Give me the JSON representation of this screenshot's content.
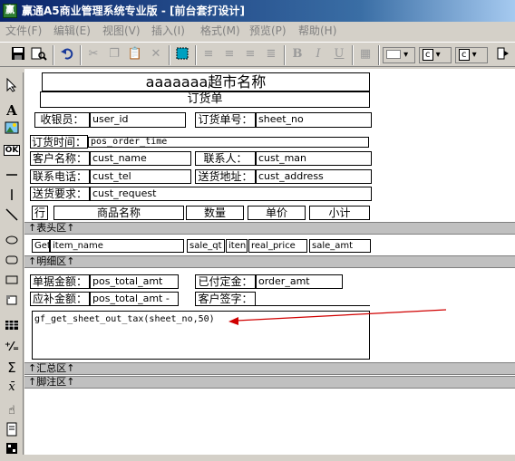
{
  "window": {
    "title": "赢通A5商业管理系统专业版 - [前台套打设计]",
    "app_icon_text": "赢"
  },
  "menu": [
    "文件(F)",
    "编辑(E)",
    "视图(V)",
    "插入(I)",
    "格式(M)",
    "预览(P)",
    "帮助(H)"
  ],
  "toolbar": {
    "bold": "B",
    "italic": "I",
    "underline": "U",
    "drop1": "c",
    "drop2": "c"
  },
  "report": {
    "store_name": "aaaaaaa超市名称",
    "doc_title": "订货单",
    "cashier_label": "收银员：",
    "cashier_value": "user_id",
    "order_no_label": "订货单号：",
    "order_no_value": "sheet_no",
    "order_time_label": "订货时间：",
    "order_time_value": "pos_order_time",
    "customer_label": "客户名称：",
    "customer_value": "cust_name",
    "contact_label": "联系人：",
    "contact_value": "cust_man",
    "phone_label": "联系电话：",
    "phone_value": "cust_tel",
    "address_label": "送货地址：",
    "address_value": "cust_address",
    "request_label": "送货要求：",
    "request_value": "cust_request",
    "col_row": "行",
    "col_name": "商品名称",
    "col_qty": "数量",
    "col_price": "单价",
    "col_subtotal": "小计",
    "header_band": "↑表头区↑",
    "detail_row": {
      "c1": "Get",
      "c2": "item_name",
      "c3": "sale_qt",
      "c4": "iten",
      "c5": "real_price",
      "c6": "sale_amt"
    },
    "detail_band": "↑明细区↑",
    "total_label": "单据金额：",
    "total_value": "pos_total_amt",
    "paid_label": "已付定金：",
    "paid_value": "order_amt",
    "due_label": "应补金额：",
    "due_value": "pos_total_amt -",
    "sign_label": "客户签字：",
    "formula": "gf_get_sheet_out_tax(sheet_no,50)",
    "summary_band": "↑汇总区↑",
    "footer_band": "↑脚注区↑"
  },
  "colors": {
    "titlebar": "#0a246a",
    "band": "#c0c0c0",
    "annotation_arrow": "#d00000"
  }
}
